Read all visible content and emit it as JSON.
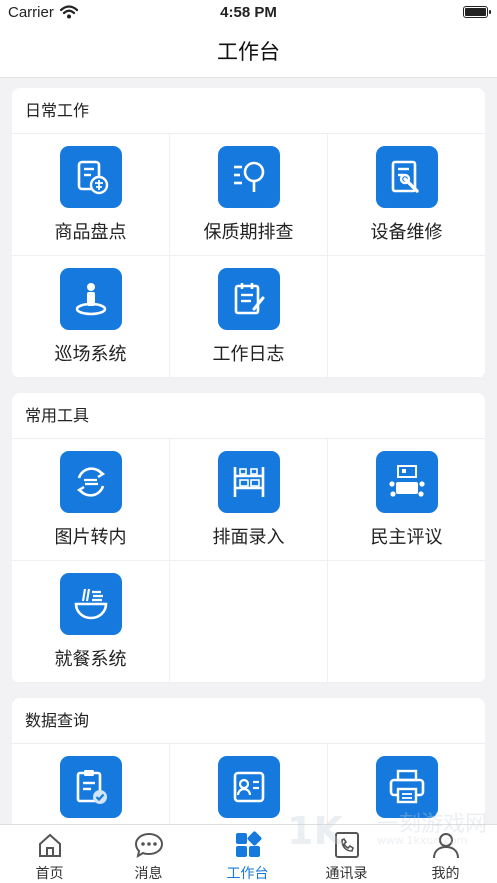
{
  "status": {
    "carrier": "Carrier",
    "time": "4:58 PM"
  },
  "header": {
    "title": "工作台"
  },
  "sections": [
    {
      "title": "日常工作",
      "items": [
        {
          "label": "商品盘点",
          "icon": "inventory-check-icon"
        },
        {
          "label": "保质期排查",
          "icon": "shelf-life-search-icon"
        },
        {
          "label": "设备维修",
          "icon": "equipment-repair-icon"
        },
        {
          "label": "巡场系统",
          "icon": "patrol-location-icon"
        },
        {
          "label": "工作日志",
          "icon": "work-log-icon"
        }
      ]
    },
    {
      "title": "常用工具",
      "items": [
        {
          "label": "图片转内",
          "icon": "image-convert-icon"
        },
        {
          "label": "排面录入",
          "icon": "shelf-entry-icon"
        },
        {
          "label": "民主评议",
          "icon": "democratic-review-icon"
        },
        {
          "label": "就餐系统",
          "icon": "dining-bowl-icon"
        }
      ]
    },
    {
      "title": "数据查询",
      "items": [
        {
          "icon": "clipboard-check-icon"
        },
        {
          "icon": "id-card-icon"
        },
        {
          "icon": "printer-icon"
        }
      ]
    }
  ],
  "tabs": [
    {
      "label": "首页",
      "icon": "home-icon"
    },
    {
      "label": "消息",
      "icon": "message-icon"
    },
    {
      "label": "工作台",
      "icon": "workbench-icon",
      "active": true
    },
    {
      "label": "通讯录",
      "icon": "contacts-icon"
    },
    {
      "label": "我的",
      "icon": "profile-icon"
    }
  ],
  "watermark": {
    "text": "一刻游戏网",
    "url": "www.1kxun.com",
    "logo": "1K"
  },
  "colors": {
    "accent": "#1679dd",
    "background": "#f2f2f4"
  }
}
